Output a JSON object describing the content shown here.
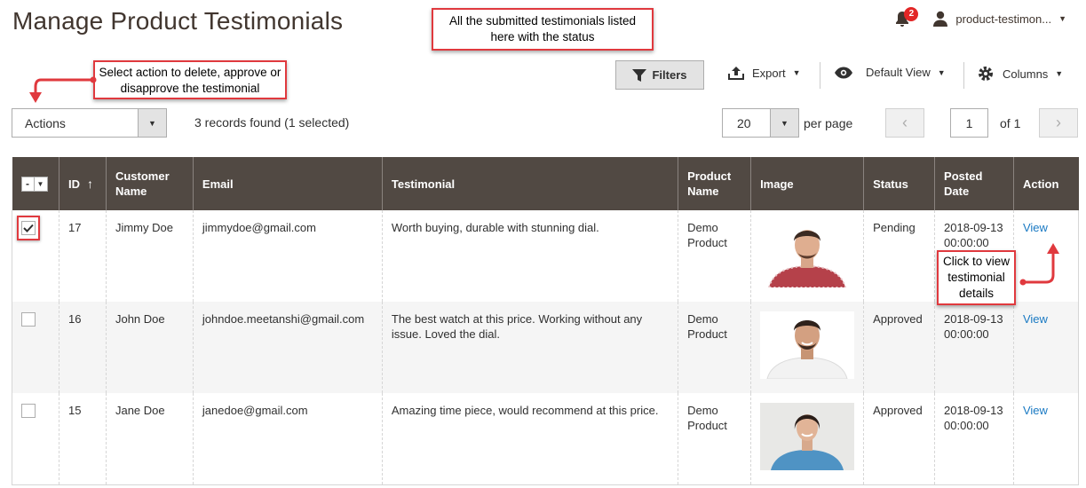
{
  "page": {
    "title": "Manage Product Testimonials"
  },
  "header": {
    "notification_count": "2",
    "user_name": "product-testimon..."
  },
  "annotations": {
    "top": "All the submitted testimonials listed here with the status",
    "actions": "Select action to delete, approve or disapprove the testimonial",
    "view": "Click to view testimonial details"
  },
  "toolbar": {
    "filters": "Filters",
    "export": "Export",
    "view": "Default View",
    "columns": "Columns"
  },
  "mass_actions": {
    "label": "Actions"
  },
  "records_text": "3 records found (1 selected)",
  "pagination": {
    "per_page_value": "20",
    "per_page_label": "per page",
    "current_page": "1",
    "of_pages": "of 1"
  },
  "grid": {
    "columns": [
      "ID",
      "Customer Name",
      "Email",
      "Testimonial",
      "Product Name",
      "Image",
      "Status",
      "Posted Date",
      "Action"
    ],
    "rows": [
      {
        "selected": true,
        "id": "17",
        "name": "Jimmy Doe",
        "email": "jimmydoe@gmail.com",
        "testimonial": "Worth buying, durable with stunning dial.",
        "product": "Demo Product",
        "image_icon": "man-checkered-shirt-photo",
        "status": "Pending",
        "date": "2018-09-13 00:00:00",
        "action": "View"
      },
      {
        "selected": false,
        "id": "16",
        "name": "John Doe",
        "email": "johndoe.meetanshi@gmail.com",
        "testimonial": "The best watch at this price. Working without any issue. Loved the dial.",
        "product": "Demo Product",
        "image_icon": "man-white-tshirt-photo",
        "status": "Approved",
        "date": "2018-09-13 00:00:00",
        "action": "View"
      },
      {
        "selected": false,
        "id": "15",
        "name": "Jane Doe",
        "email": "janedoe@gmail.com",
        "testimonial": "Amazing time piece, would recommend at this price.",
        "product": "Demo Product",
        "image_icon": "woman-blue-shirt-photo",
        "status": "Approved",
        "date": "2018-09-13 00:00:00",
        "action": "View"
      }
    ]
  },
  "colors": {
    "header_bg": "#514943",
    "link": "#1979c3",
    "annotation_border": "#e0393e",
    "badge": "#e22626"
  }
}
